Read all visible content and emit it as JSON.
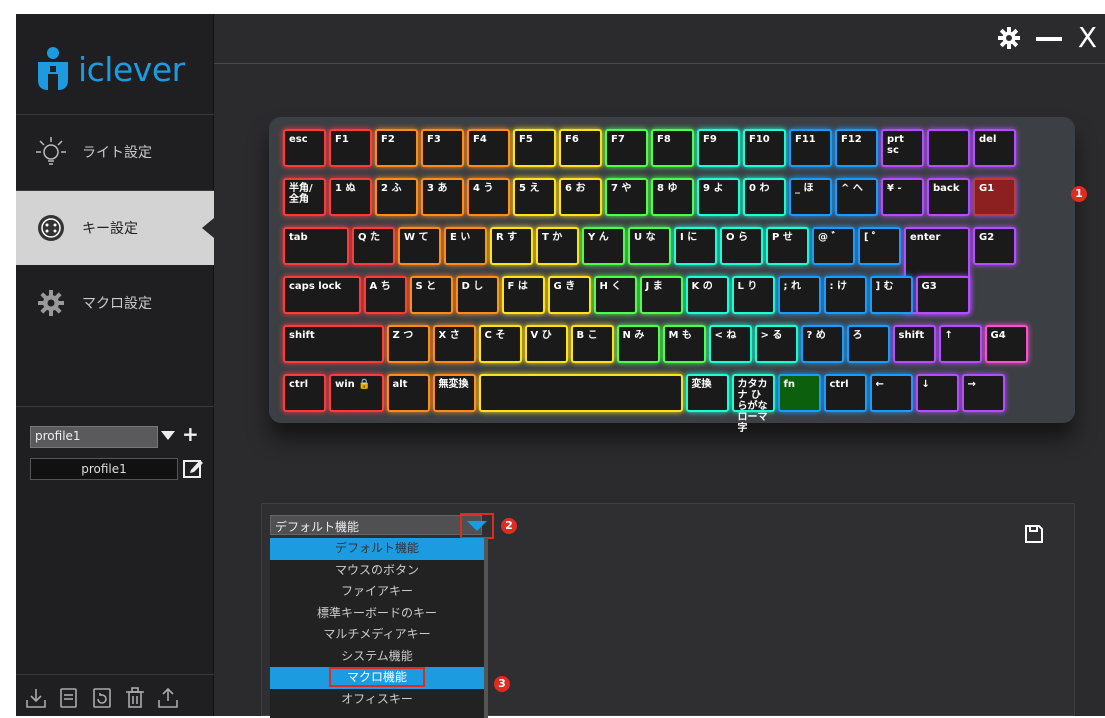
{
  "app": {
    "brand": "iclever",
    "accent": "#1c9be0"
  },
  "sidebar": {
    "items": [
      {
        "label": "ライト設定",
        "icon": "bulb-icon"
      },
      {
        "label": "キー設定",
        "icon": "keyboard-face-icon"
      },
      {
        "label": "マクロ設定",
        "icon": "gear-icon"
      }
    ],
    "profile_select": "profile1",
    "profile_name": "profile1",
    "bottom_icons": [
      "import-icon",
      "notes-icon",
      "refresh-icon",
      "trash-icon",
      "export-icon"
    ]
  },
  "window_controls": {
    "close": "X"
  },
  "keyboard": {
    "rows": [
      [
        "esc",
        "F1",
        "F2",
        "F3",
        "F4",
        "F5",
        "F6",
        "F7",
        "F8",
        "F9",
        "F10",
        "F11",
        "F12",
        "prt sc",
        "",
        "del"
      ],
      [
        "半角/全角",
        "1 ぬ",
        "2 ふ",
        "3 あ",
        "4 う",
        "5 え",
        "6 お",
        "7 や",
        "8 ゆ",
        "9 よ",
        "0 わ",
        "_ ほ",
        "^ へ",
        "¥ -",
        "back",
        "G1"
      ],
      [
        "tab",
        "Q た",
        "W て",
        "E い",
        "R す",
        "T か",
        "Y ん",
        "U な",
        "I に",
        "O ら",
        "P せ",
        "@ ゛",
        "[ ゜",
        "enter",
        "G2"
      ],
      [
        "caps lock",
        "A ち",
        "S と",
        "D し",
        "F は",
        "G き",
        "H く",
        "J ま",
        "K の",
        "L り",
        "; れ",
        ": け",
        "] む",
        "G3"
      ],
      [
        "shift",
        "Z つ",
        "X さ",
        "C そ",
        "V ひ",
        "B こ",
        "N み",
        "M も",
        "< ね",
        "> る",
        "? め",
        "ろ",
        "shift",
        "↑",
        "G4"
      ],
      [
        "ctrl",
        "win 🔒",
        "alt",
        "無変換",
        "",
        "変換",
        "カタカナ ひらがな ローマ字",
        "fn",
        "ctrl",
        "←",
        "↓",
        "→"
      ]
    ],
    "markers": [
      "1",
      "2",
      "3"
    ]
  },
  "function_panel": {
    "selected": "デフォルト機能",
    "options": [
      "デフォルト機能",
      "マウスのボタン",
      "ファイアキー",
      "標準キーボードのキー",
      "マルチメディアキー",
      "システム機能",
      "マクロ機能",
      "オフィスキー"
    ]
  }
}
